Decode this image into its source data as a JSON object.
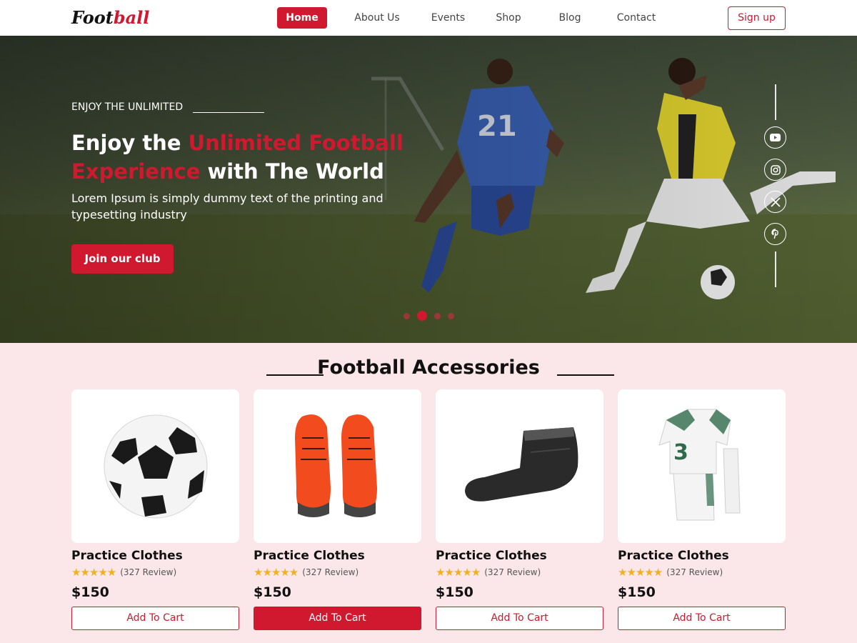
{
  "brand": {
    "logo_part1": "Foot",
    "logo_part2": "ball"
  },
  "nav": {
    "items": [
      "Home",
      "About Us",
      "Events",
      "Shop",
      "Blog",
      "Contact"
    ],
    "active": "Home",
    "signup": "Sign up"
  },
  "hero": {
    "eyebrow": "ENJOY THE UNLIMITED",
    "headline_1": "Enjoy the ",
    "headline_red": "Unlimited Football Experience",
    "headline_2": " with The World",
    "subtext": "Lorem Ipsum is simply dummy text of the printing and typesetting industry",
    "cta": "Join our club",
    "social_icons": [
      "youtube-icon",
      "instagram-icon",
      "x-icon",
      "pinterest-icon"
    ],
    "slide_count": 4,
    "active_slide": 2
  },
  "accessories": {
    "title": "Football Accessories",
    "products": [
      {
        "name": "Practice Clothes",
        "rating": 5,
        "reviews": "(327 Review)",
        "price": "$150",
        "cart": "Add To Cart",
        "image_icon": "soccer-ball-icon"
      },
      {
        "name": "Practice Clothes",
        "rating": 5,
        "reviews": "(327 Review)",
        "price": "$150",
        "cart": "Add To Cart",
        "image_icon": "football-boots-icon"
      },
      {
        "name": "Practice Clothes",
        "rating": 5,
        "reviews": "(327 Review)",
        "price": "$150",
        "cart": "Add To Cart",
        "image_icon": "sock-icon"
      },
      {
        "name": "Practice Clothes",
        "rating": 5,
        "reviews": "(327 Review)",
        "price": "$150",
        "cart": "Add To Cart",
        "image_icon": "jersey-kit-icon"
      }
    ]
  },
  "colors": {
    "accent": "#d0182f",
    "section_bg": "#fbe7ea",
    "star": "#f2b01e"
  }
}
